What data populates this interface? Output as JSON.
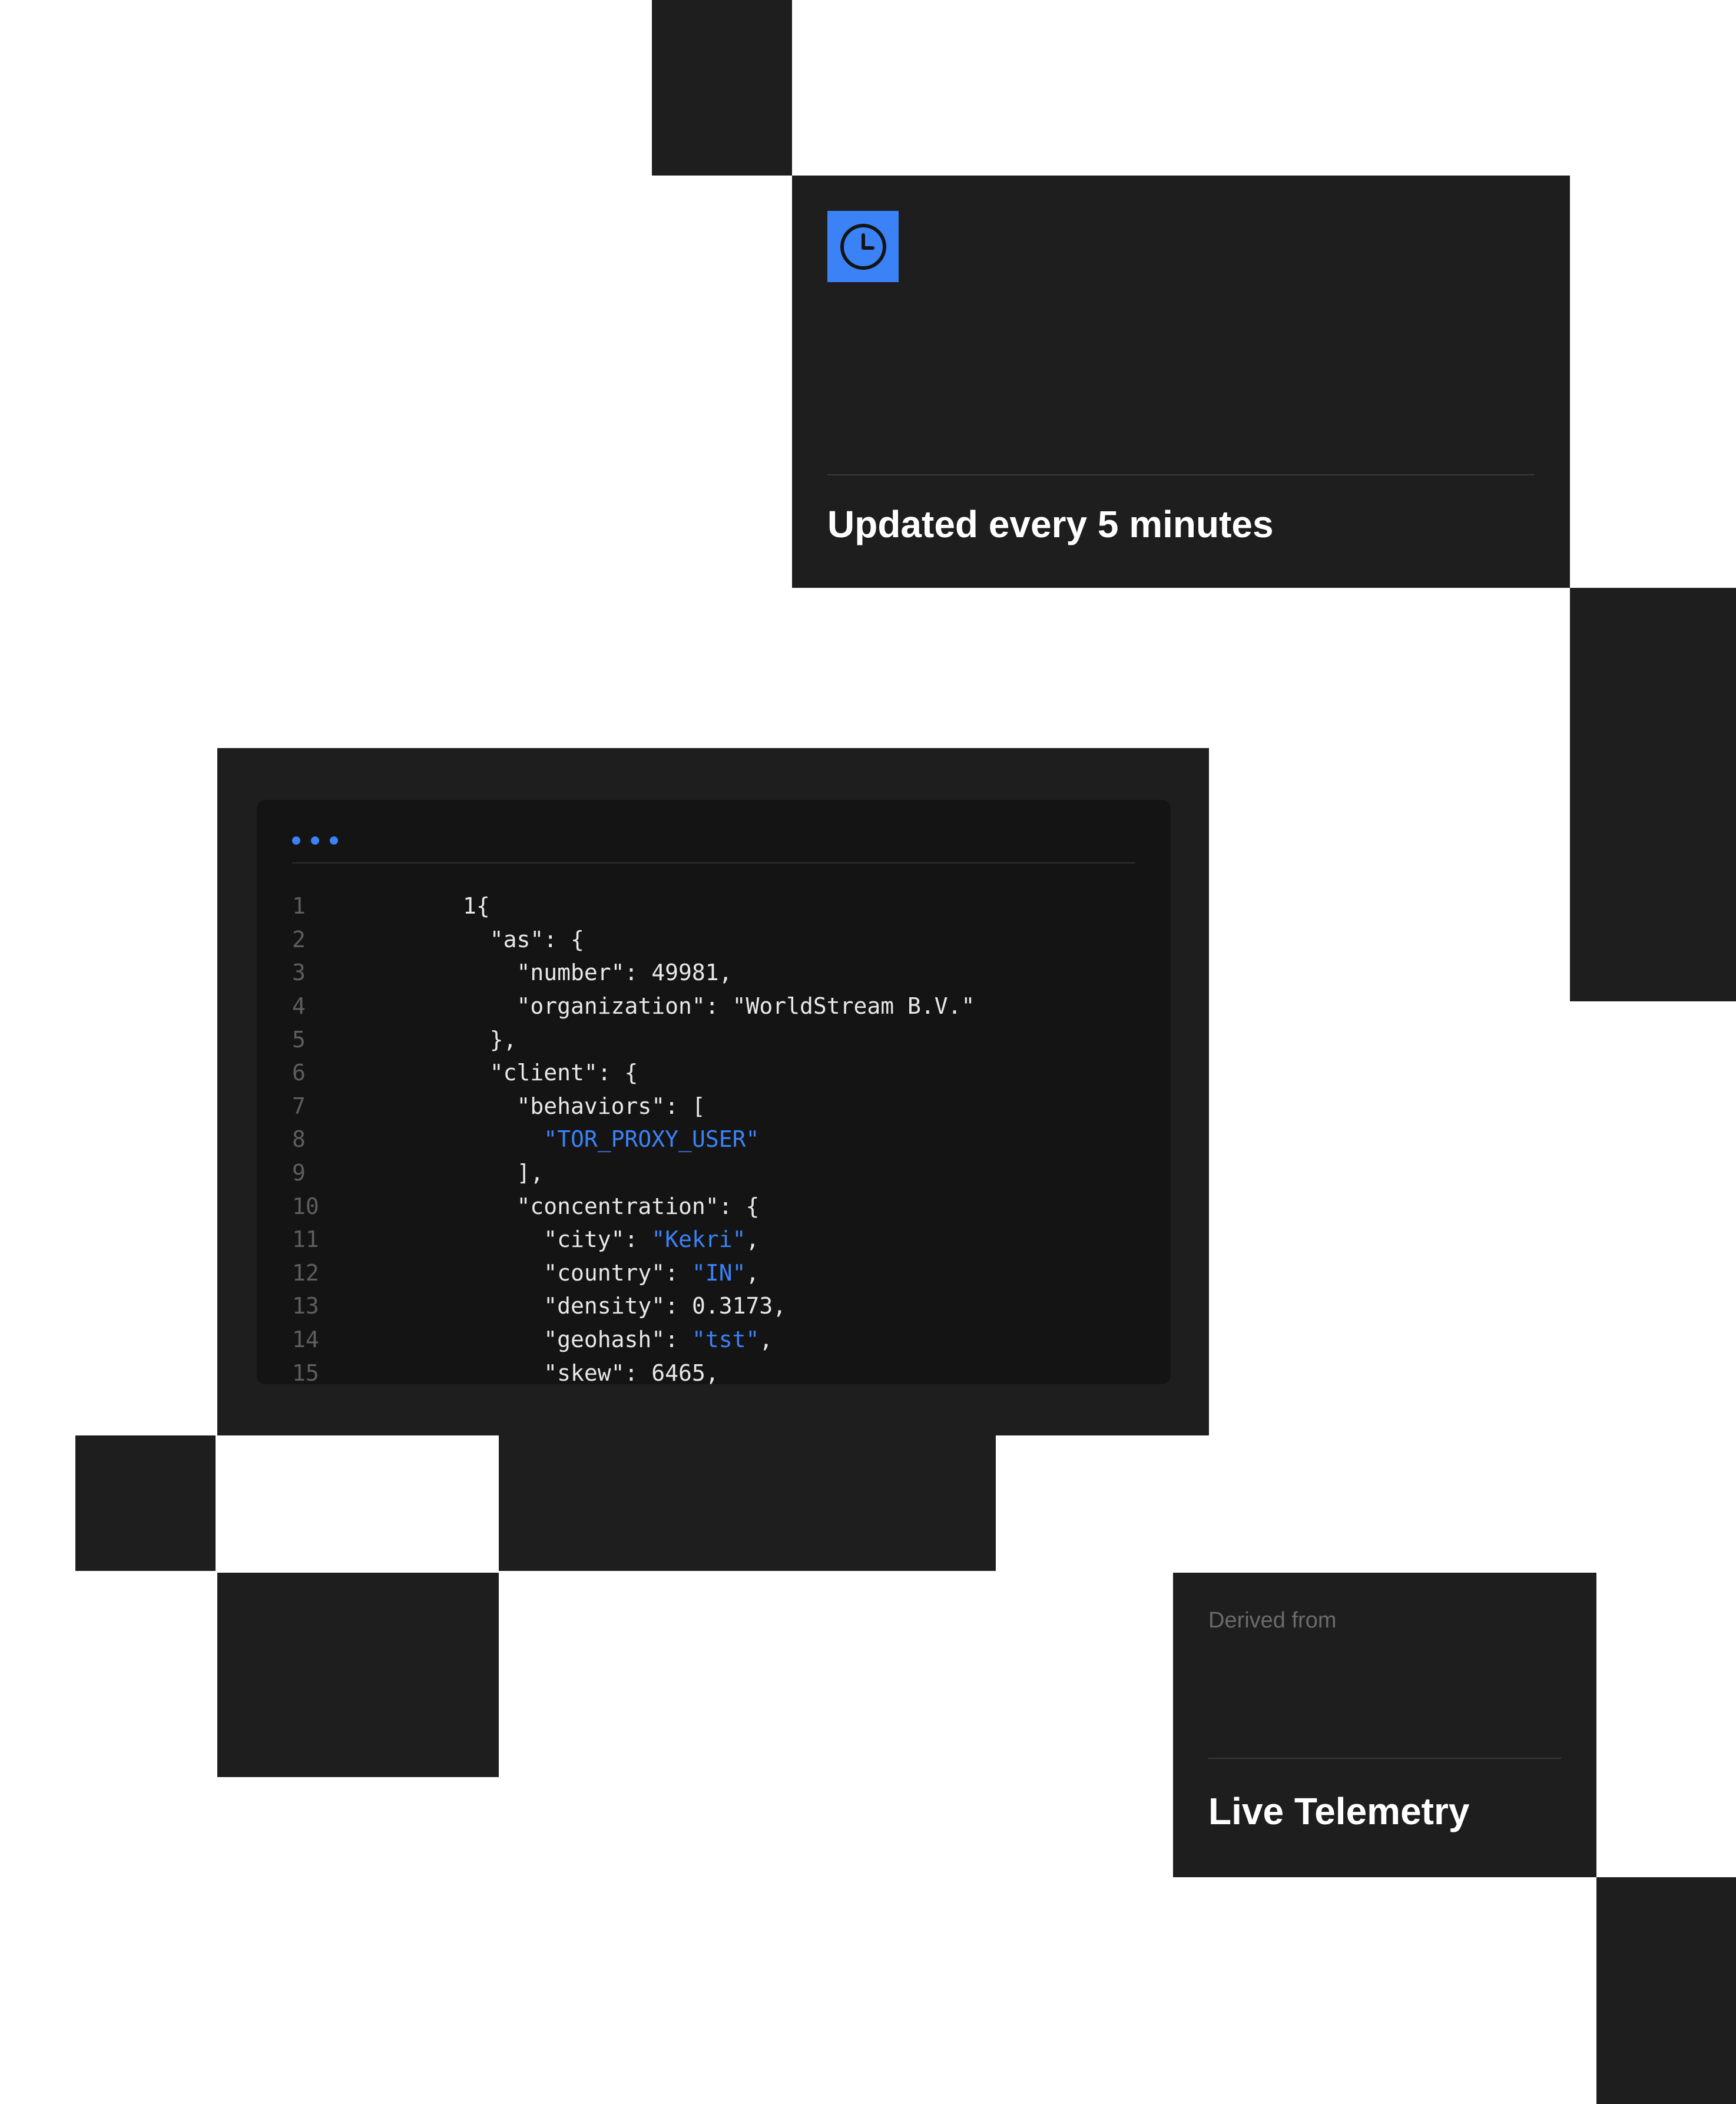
{
  "update_card": {
    "icon": "clock-icon",
    "title": "Updated every 5 minutes"
  },
  "code_window": {
    "lines": [
      {
        "num": "1",
        "indent": "",
        "parts": [
          {
            "t": "1{",
            "s": false
          }
        ]
      },
      {
        "num": "2",
        "indent": "  ",
        "parts": [
          {
            "t": "\"as\": {",
            "s": false
          }
        ]
      },
      {
        "num": "3",
        "indent": "    ",
        "parts": [
          {
            "t": "\"number\": 49981,",
            "s": false
          }
        ]
      },
      {
        "num": "4",
        "indent": "    ",
        "parts": [
          {
            "t": "\"organization\": \"WorldStream B.V.\"",
            "s": false
          }
        ]
      },
      {
        "num": "5",
        "indent": "  ",
        "parts": [
          {
            "t": "},",
            "s": false
          }
        ]
      },
      {
        "num": "6",
        "indent": "  ",
        "parts": [
          {
            "t": "\"client\": {",
            "s": false
          }
        ]
      },
      {
        "num": "7",
        "indent": "    ",
        "parts": [
          {
            "t": "\"behaviors\": [",
            "s": false
          }
        ]
      },
      {
        "num": "8",
        "indent": "      ",
        "parts": [
          {
            "t": "\"TOR_PROXY_USER\"",
            "s": true
          }
        ]
      },
      {
        "num": "9",
        "indent": "    ",
        "parts": [
          {
            "t": "],",
            "s": false
          }
        ]
      },
      {
        "num": "10",
        "indent": "    ",
        "parts": [
          {
            "t": "\"concentration\": {",
            "s": false
          }
        ]
      },
      {
        "num": "11",
        "indent": "      ",
        "parts": [
          {
            "t": "\"city\": ",
            "s": false
          },
          {
            "t": "\"Kekri\"",
            "s": true
          },
          {
            "t": ",",
            "s": false
          }
        ]
      },
      {
        "num": "12",
        "indent": "      ",
        "parts": [
          {
            "t": "\"country\": ",
            "s": false
          },
          {
            "t": "\"IN\"",
            "s": true
          },
          {
            "t": ",",
            "s": false
          }
        ]
      },
      {
        "num": "13",
        "indent": "      ",
        "parts": [
          {
            "t": "\"density\": 0.3173,",
            "s": false
          }
        ]
      },
      {
        "num": "14",
        "indent": "      ",
        "parts": [
          {
            "t": "\"geohash\": ",
            "s": false
          },
          {
            "t": "\"tst\"",
            "s": true
          },
          {
            "t": ",",
            "s": false
          }
        ]
      },
      {
        "num": "15",
        "indent": "      ",
        "parts": [
          {
            "t": "\"skew\": 6465,",
            "s": false
          }
        ]
      }
    ]
  },
  "telemetry_card": {
    "label": "Derived from",
    "title": "Live Telemetry"
  },
  "colors": {
    "accent": "#3b82f6",
    "panel": "#1e1e1e",
    "code_bg": "#141414",
    "background": "#ffffff"
  }
}
